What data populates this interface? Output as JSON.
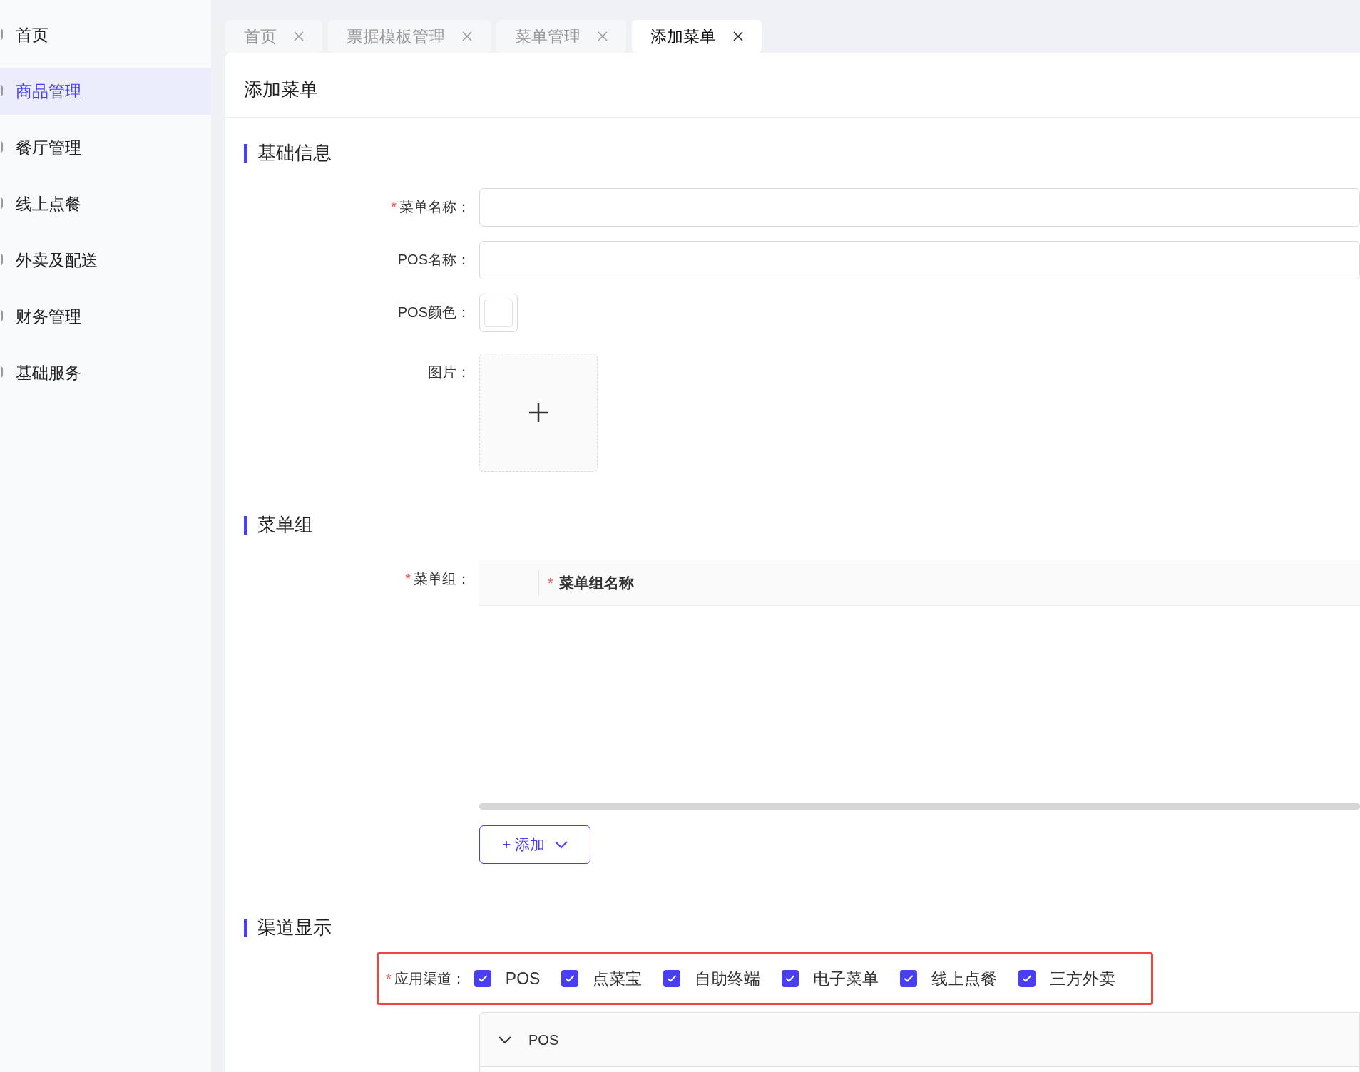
{
  "sidebar": {
    "items": [
      {
        "label": "首页",
        "selected": false
      },
      {
        "label": "商品管理",
        "selected": true
      },
      {
        "label": "餐厅管理",
        "selected": false
      },
      {
        "label": "线上点餐",
        "selected": false
      },
      {
        "label": "外卖及配送",
        "selected": false
      },
      {
        "label": "财务管理",
        "selected": false
      },
      {
        "label": "基础服务",
        "selected": false
      }
    ]
  },
  "tabs": [
    {
      "label": "首页",
      "selected": false
    },
    {
      "label": "票据模板管理",
      "selected": false
    },
    {
      "label": "菜单管理",
      "selected": false
    },
    {
      "label": "添加菜单",
      "selected": true
    }
  ],
  "page_title": "添加菜单",
  "sections": [
    {
      "title": "基础信息",
      "fields": [
        {
          "kind": "text",
          "label": "菜单名称：",
          "required_mark": "*"
        },
        {
          "kind": "text",
          "label": "POS名称："
        },
        {
          "kind": "color",
          "label": "POS颜色："
        },
        {
          "kind": "upload",
          "label": "图片："
        }
      ]
    },
    {
      "title": "菜单组",
      "fields": [
        {
          "kind": "table",
          "label": "菜单组：",
          "required_mark": "*",
          "columns": [
            {
              "label": "菜单组名称",
              "required_mark": "*"
            }
          ],
          "add_button": "+ 添加"
        }
      ]
    },
    {
      "title": "渠道显示",
      "fields": [
        {
          "kind": "channels",
          "label": "应用渠道：",
          "required_mark": "*",
          "highlighted": true,
          "options": [
            {
              "label": "POS",
              "checked": true
            },
            {
              "label": "点菜宝",
              "checked": true
            },
            {
              "label": "自助终端",
              "checked": true
            },
            {
              "label": "电子菜单",
              "checked": true
            },
            {
              "label": "线上点餐",
              "checked": true
            },
            {
              "label": "三方外卖",
              "checked": true
            }
          ],
          "panel": {
            "title": "POS",
            "expanded": true
          }
        }
      ]
    }
  ]
}
